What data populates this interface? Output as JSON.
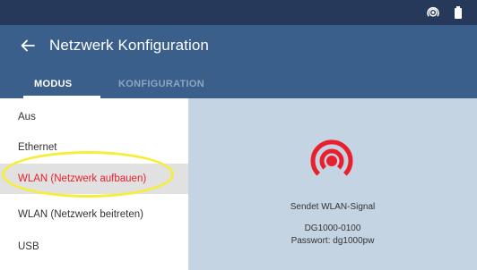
{
  "app": {
    "title": "Netzwerk Konfiguration"
  },
  "statusbar": {
    "icons": [
      "hotspot-icon",
      "battery-icon"
    ]
  },
  "tabs": [
    {
      "label": "MODUS",
      "active": true
    },
    {
      "label": "KONFIGURATION",
      "active": false
    }
  ],
  "sidebar": {
    "items": [
      {
        "label": "Aus",
        "selected": false
      },
      {
        "label": "Ethernet",
        "selected": false
      },
      {
        "label": "WLAN (Netzwerk aufbauen)",
        "selected": true
      },
      {
        "label": "WLAN (Netzwerk beitreten)",
        "selected": false
      },
      {
        "label": "USB",
        "selected": false
      }
    ]
  },
  "content": {
    "icon": "wifi-broadcast-icon",
    "status": "Sendet WLAN-Signal",
    "ssid": "DG1000-0100",
    "password": "Passwort: dg1000pw"
  },
  "colors": {
    "statusbar": "#27395a",
    "appbar": "#3a5f8a",
    "accent_red": "#e8202e",
    "content_bg": "#c5d4e3",
    "highlight": "#f6ee3a"
  }
}
